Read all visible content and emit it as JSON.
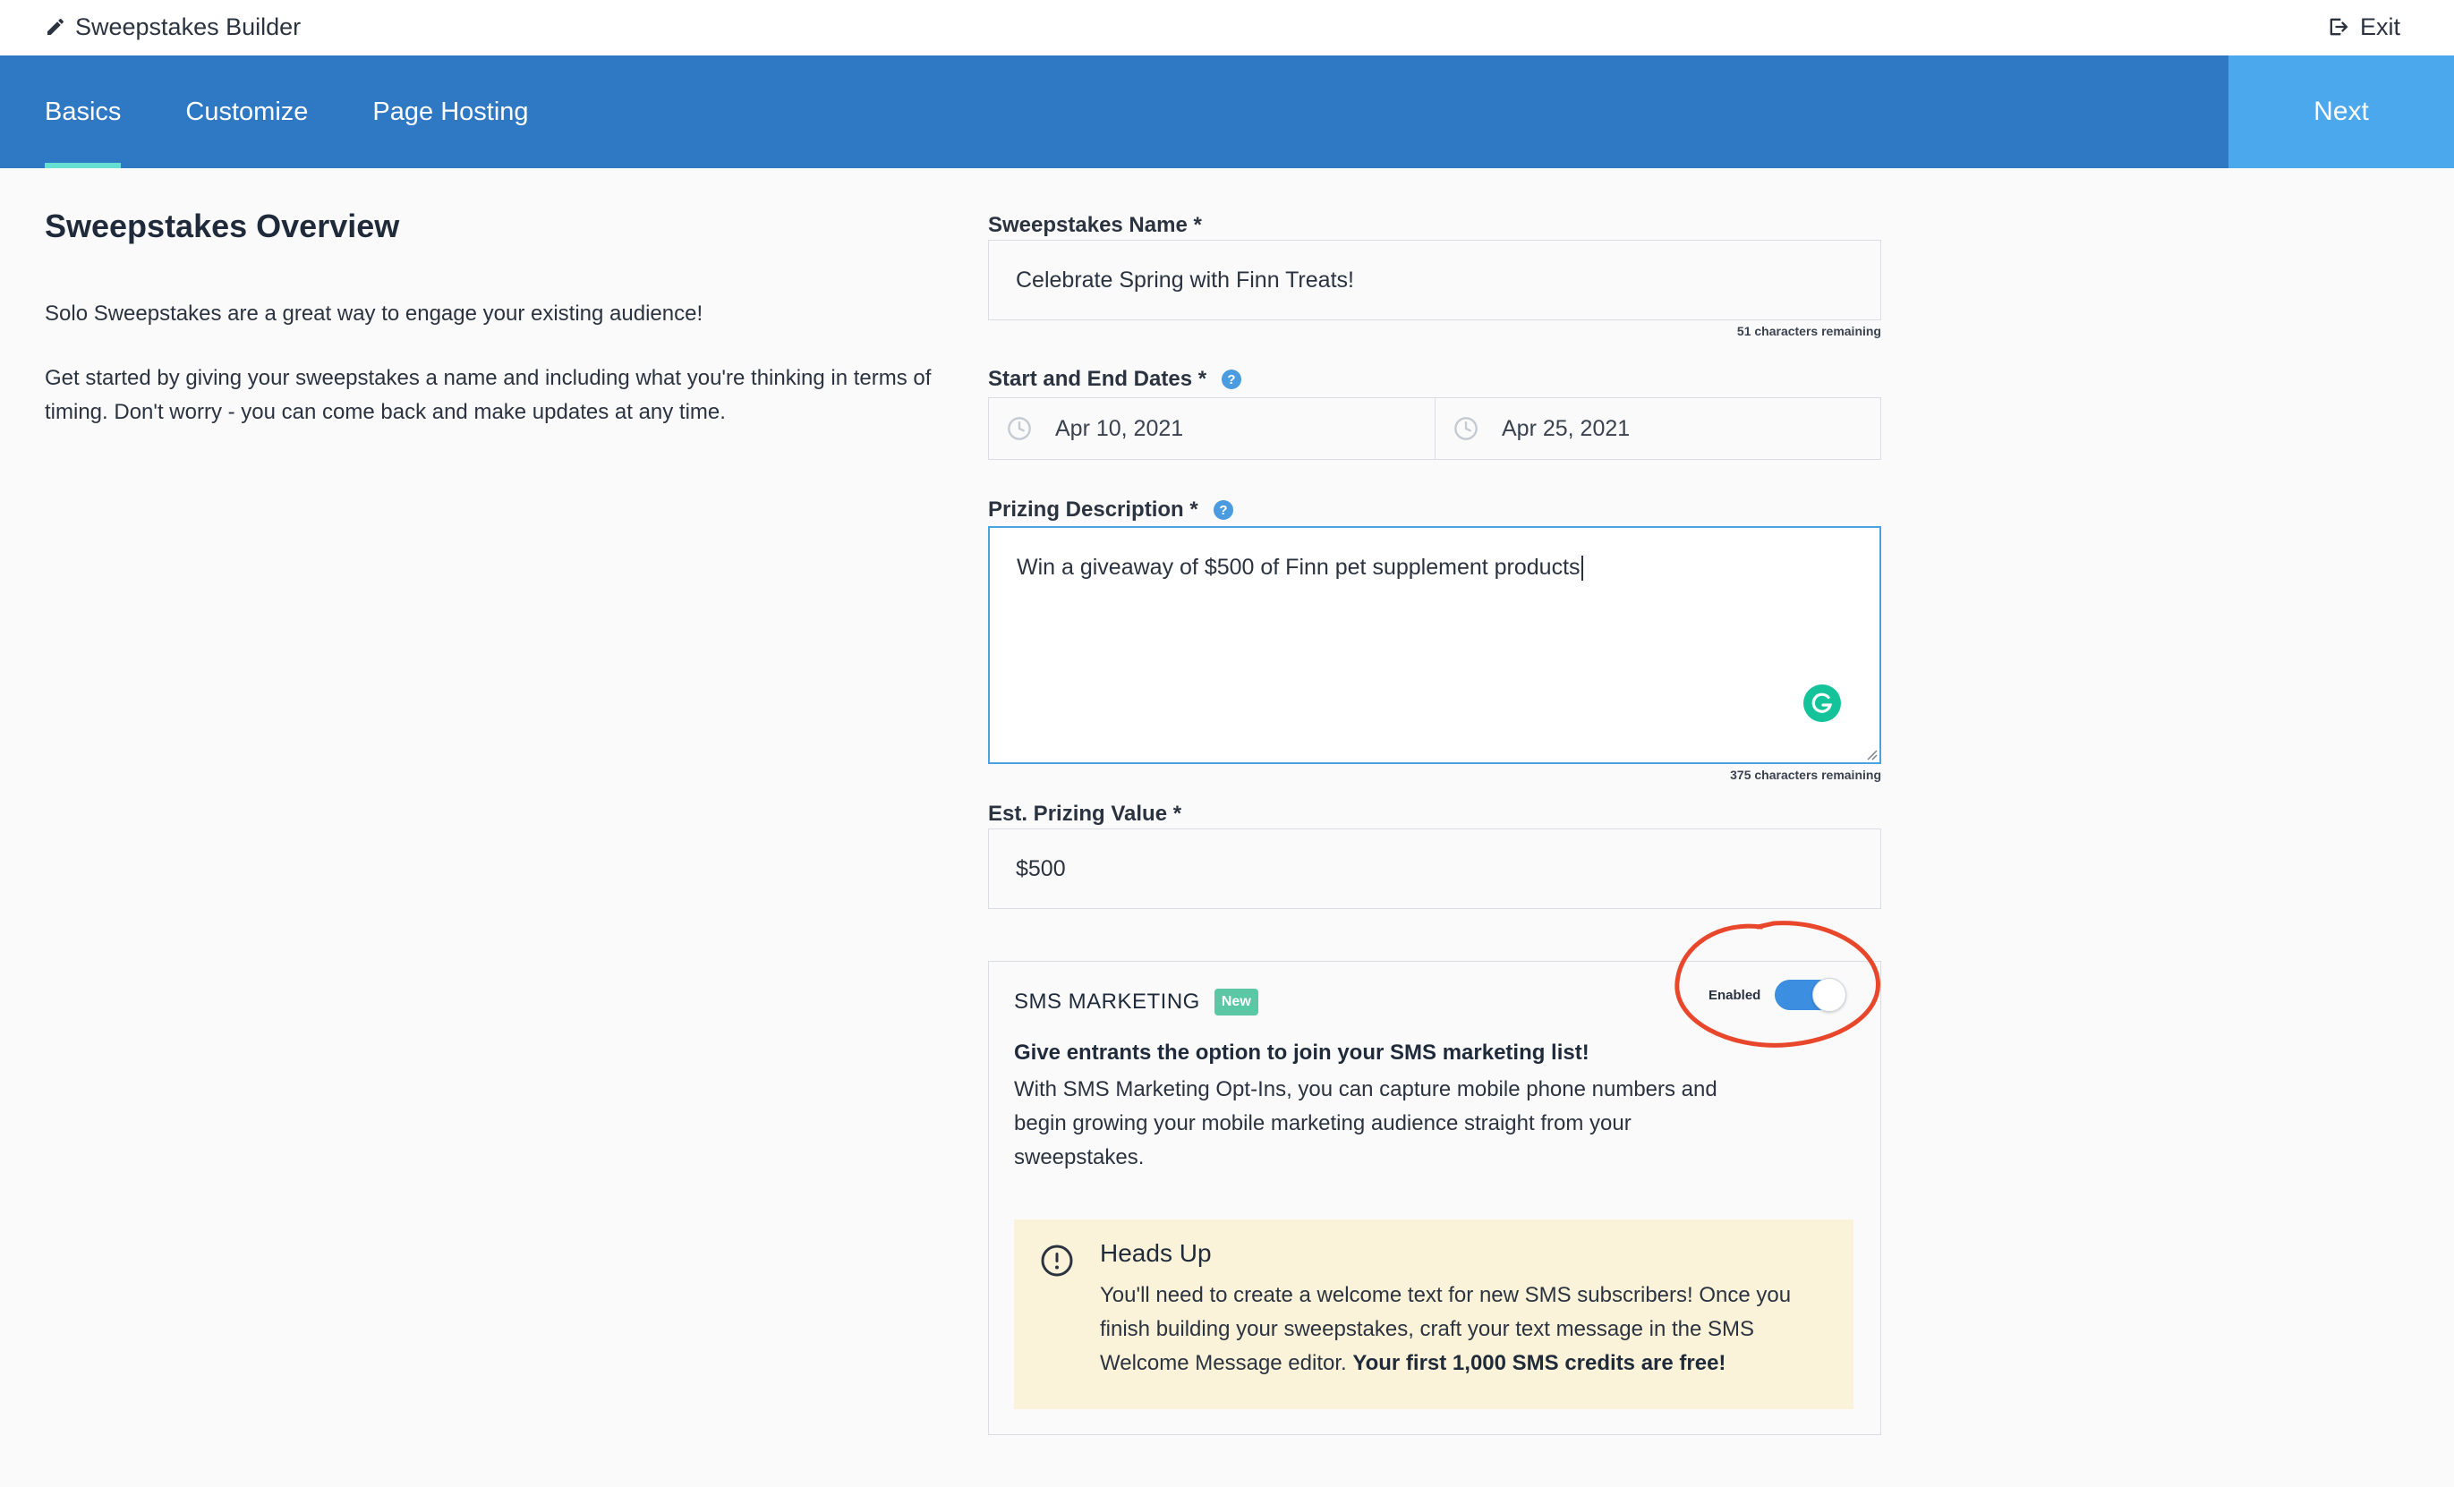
{
  "app": {
    "title": "Sweepstakes Builder",
    "exit_label": "Exit"
  },
  "nav": {
    "tabs": [
      {
        "label": "Basics",
        "active": true
      },
      {
        "label": "Customize",
        "active": false
      },
      {
        "label": "Page Hosting",
        "active": false
      }
    ],
    "next_label": "Next"
  },
  "overview": {
    "title": "Sweepstakes Overview",
    "paragraph1": "Solo Sweepstakes are a great way to engage your existing audience!",
    "paragraph2": "Get started by giving your sweepstakes a name and including what you're thinking in terms of timing. Don't worry - you can come back and make updates at any time."
  },
  "form": {
    "name": {
      "label": "Sweepstakes Name *",
      "value": "Celebrate Spring with Finn Treats!",
      "counter": "51 characters remaining"
    },
    "dates": {
      "label": "Start and End Dates *",
      "start": "Apr 10, 2021",
      "end": "Apr 25, 2021"
    },
    "prizing_description": {
      "label": "Prizing Description *",
      "value": "Win a giveaway of $500 of Finn pet supplement products",
      "counter": "375 characters remaining"
    },
    "prizing_value": {
      "label": "Est. Prizing Value *",
      "value": "$500"
    }
  },
  "sms": {
    "title": "SMS MARKETING",
    "badge": "New",
    "toggle_label": "Enabled",
    "toggle_on": true,
    "heading": "Give entrants the option to join your SMS marketing list!",
    "body": "With SMS Marketing Opt-Ins, you can capture mobile phone numbers and begin growing your mobile marketing audience straight from your sweepstakes.",
    "headsup": {
      "title": "Heads Up",
      "body": "You'll need to create a welcome text for new SMS subscribers! Once you finish building your sweepstakes, craft your text message in the SMS Welcome Message editor.",
      "bold_tail": "Your first 1,000 SMS credits are free!"
    }
  },
  "colors": {
    "nav_bg": "#2f78c4",
    "next_bg": "#4ba8ec",
    "active_tab_underline": "#67e0d4",
    "badge_bg": "#5cc7a4",
    "toggle_on": "#3b8ee0",
    "headsup_bg": "#fbf3d9",
    "annotation_red": "#e8472b"
  },
  "icons": [
    "pencil-icon",
    "exit-icon",
    "help-icon",
    "clock-icon",
    "grammarly-icon",
    "warning-icon"
  ]
}
